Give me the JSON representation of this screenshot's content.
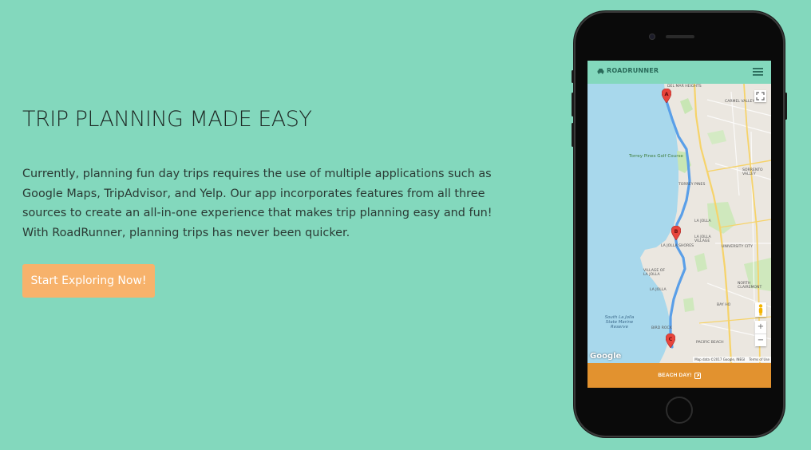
{
  "hero": {
    "title": "TRIP PLANNING MADE EASY",
    "description": "Currently, planning fun day trips requires the use of multiple applications such as Google Maps, TripAdvisor, and Yelp. Our app incorporates features from all three sources to create an all-in-one experience that makes trip planning easy and fun! With RoadRunner, planning trips has never been quicker.",
    "cta_label": "Start Exploring Now!"
  },
  "app": {
    "brand": "ROADRUNNER",
    "brand_icon": "car-icon",
    "menu_icon": "hamburger-menu-icon",
    "footer_label": "BEACH DAY!",
    "footer_icon": "external-link-icon"
  },
  "map": {
    "markers": [
      "A",
      "B",
      "C"
    ],
    "labels": {
      "carmel_valley": "CARMEL VALLEY",
      "torrey_pines_golf": "Torrey Pines Golf Course",
      "torrey_pines": "TORREY PINES",
      "sorrento_valley": "SORRENTO VALLEY",
      "la_jolla_village": "LA JOLLA VILLAGE",
      "la_jolla": "LA JOLLA",
      "la_jolla_shores": "LA JOLLA SHORES",
      "university_city": "UNIVERSITY CITY",
      "village_of_la_jolla": "VILLAGE OF LA JOLLA",
      "north_clairemont": "NORTH CLAIREMONT",
      "bay_ho": "BAY HO",
      "bird_rock": "BIRD ROCK",
      "pacific_beach": "PACIFIC BEACH",
      "marine_reserve": "South La Jolla State Marine Reserve",
      "del_mar_heights": "DEL MAR HEIGHTS"
    },
    "zoom_in": "+",
    "zoom_out": "−",
    "google_logo": "Google",
    "attribution": "Map data ©2017 Google, INEGI",
    "terms": "Terms of Use"
  },
  "colors": {
    "background": "#83d8bd",
    "cta": "#f7b26b",
    "footer": "#e2922f",
    "route": "#5a9fe8",
    "marker": "#e8453c",
    "water": "#a8d8ec"
  }
}
